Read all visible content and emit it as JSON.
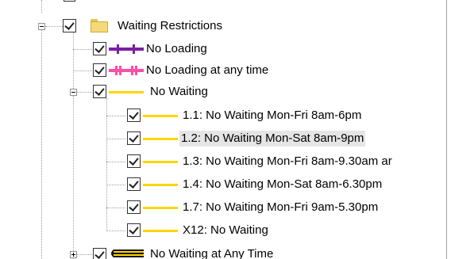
{
  "tree": {
    "root": {
      "label": "Waiting Restrictions",
      "expanded": true,
      "checked": true,
      "icon": "folder-icon"
    },
    "items": [
      {
        "label": "No Loading",
        "symbol": "purple-line-with-ticks",
        "color": "#7b1fa2",
        "checked": true
      },
      {
        "label": "No Loading at any time",
        "symbol": "pink-line-with-ticks",
        "color": "#ff4fa3",
        "checked": true
      },
      {
        "label": "No Waiting",
        "symbol": "yellow-line",
        "color": "#ffd400",
        "checked": true,
        "expanded": true,
        "children": [
          {
            "label": "1.1: No Waiting Mon-Fri 8am-6pm",
            "color": "#ffd400",
            "checked": true,
            "selected": false
          },
          {
            "label": "1.2: No Waiting Mon-Sat 8am-9pm",
            "color": "#ffd400",
            "checked": true,
            "selected": true
          },
          {
            "label": "1.3: No Waiting Mon-Fri 8am-9.30am ar",
            "color": "#ffd400",
            "checked": true,
            "selected": false
          },
          {
            "label": "1.4: No Waiting Mon-Sat 8am-6.30pm",
            "color": "#ffd400",
            "checked": true,
            "selected": false
          },
          {
            "label": "1.7: No Waiting Mon-Fri 9am-5.30pm",
            "color": "#ffd400",
            "checked": true,
            "selected": false
          },
          {
            "label": "X12: No Waiting",
            "color": "#ffd400",
            "checked": true,
            "selected": false
          }
        ]
      },
      {
        "label": "No Waiting at Any Time",
        "symbol": "double-yellow-line",
        "color": "#ffd400",
        "checked": true,
        "expanded": false
      }
    ]
  }
}
